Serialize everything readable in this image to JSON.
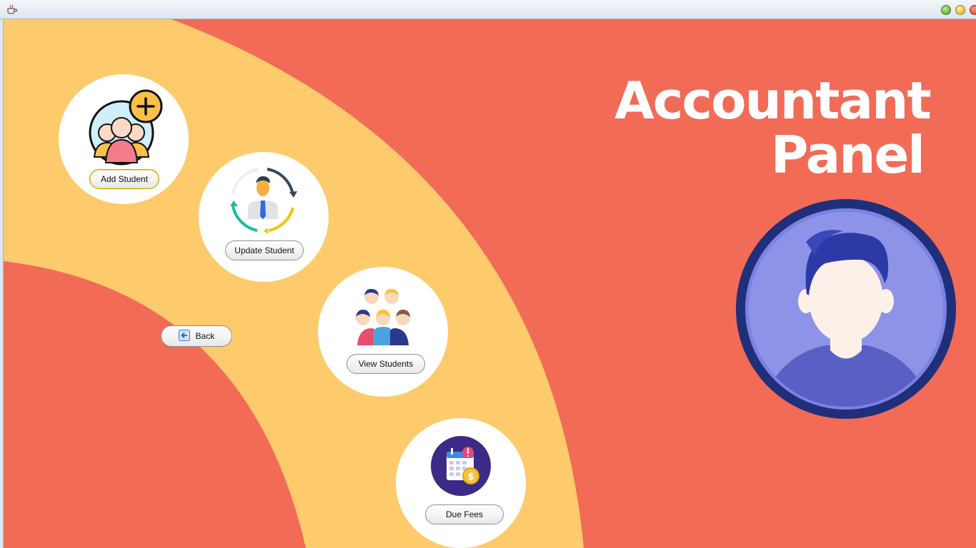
{
  "window": {
    "app_icon": "java-cup-icon",
    "controls": [
      "maximize-button",
      "minimize-button",
      "close-button"
    ]
  },
  "panel": {
    "title_line1": "Accountant",
    "title_line2": "Panel",
    "avatar_icon": "accountant-avatar-icon"
  },
  "actions": {
    "add_student": "Add Student",
    "update_student": "Update Student",
    "view_students": "View Students",
    "due_fees": "Due Fees",
    "back": "Back"
  },
  "icons": {
    "add_student": "add-student-group-icon",
    "update_student": "update-student-cycle-icon",
    "view_students": "students-group-icon",
    "due_fees": "fees-calendar-icon",
    "back": "back-arrow-icon"
  },
  "colors": {
    "background": "#f26b57",
    "arc": "#fdcb6b",
    "node": "#ffffff",
    "avatar_ring": "#1f2f7a",
    "avatar_fill": "#8d93e6"
  }
}
